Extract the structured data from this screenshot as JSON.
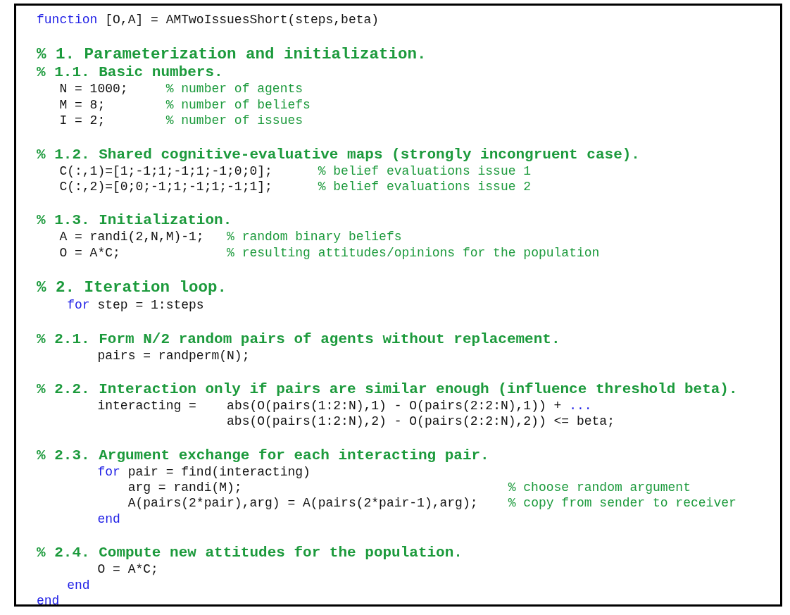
{
  "lines": [
    {
      "kind": "code",
      "segments": [
        {
          "kind": "keyword",
          "text": "function"
        },
        {
          "kind": "code",
          "text": " [O,A] = AMTwoIssuesShort(steps,beta)"
        }
      ]
    },
    {
      "kind": "blank"
    },
    {
      "kind": "section",
      "text": "% 1. Parameterization and initialization."
    },
    {
      "kind": "subsection",
      "text": "% 1.1. Basic numbers."
    },
    {
      "kind": "code",
      "segments": [
        {
          "kind": "code",
          "text": "   N = 1000;     "
        },
        {
          "kind": "comment",
          "text": "% number of agents"
        }
      ]
    },
    {
      "kind": "code",
      "segments": [
        {
          "kind": "code",
          "text": "   M = 8;        "
        },
        {
          "kind": "comment",
          "text": "% number of beliefs"
        }
      ]
    },
    {
      "kind": "code",
      "segments": [
        {
          "kind": "code",
          "text": "   I = 2;        "
        },
        {
          "kind": "comment",
          "text": "% number of issues"
        }
      ]
    },
    {
      "kind": "blank"
    },
    {
      "kind": "subsection",
      "text": "% 1.2. Shared cognitive-evaluative maps (strongly incongruent case)."
    },
    {
      "kind": "code",
      "segments": [
        {
          "kind": "code",
          "text": "   C(:,1)=[1;-1;1;-1;1;-1;0;0];      "
        },
        {
          "kind": "comment",
          "text": "% belief evaluations issue 1"
        }
      ]
    },
    {
      "kind": "code",
      "segments": [
        {
          "kind": "code",
          "text": "   C(:,2)=[0;0;-1;1;-1;1;-1;1];      "
        },
        {
          "kind": "comment",
          "text": "% belief evaluations issue 2"
        }
      ]
    },
    {
      "kind": "blank"
    },
    {
      "kind": "subsection",
      "text": "% 1.3. Initialization."
    },
    {
      "kind": "code",
      "segments": [
        {
          "kind": "code",
          "text": "   A = randi(2,N,M)-1;   "
        },
        {
          "kind": "comment",
          "text": "% random binary beliefs"
        }
      ]
    },
    {
      "kind": "code",
      "segments": [
        {
          "kind": "code",
          "text": "   O = A*C;              "
        },
        {
          "kind": "comment",
          "text": "% resulting attitudes/opinions for the population"
        }
      ]
    },
    {
      "kind": "blank"
    },
    {
      "kind": "section",
      "text": "% 2. Iteration loop."
    },
    {
      "kind": "code",
      "segments": [
        {
          "kind": "keyword",
          "text": "    for"
        },
        {
          "kind": "code",
          "text": " step = 1:steps"
        }
      ]
    },
    {
      "kind": "blank"
    },
    {
      "kind": "subsection",
      "text": "% 2.1. Form N/2 random pairs of agents without replacement."
    },
    {
      "kind": "code",
      "segments": [
        {
          "kind": "code",
          "text": "        pairs = randperm(N);"
        }
      ]
    },
    {
      "kind": "blank"
    },
    {
      "kind": "subsection",
      "text": "% 2.2. Interaction only if pairs are similar enough (influence threshold beta)."
    },
    {
      "kind": "code",
      "segments": [
        {
          "kind": "code",
          "text": "        interacting =    "
        },
        {
          "kind": "code",
          "text": "abs(O(pairs(1:2:N),1) - O(pairs(2:2:N),1)) + "
        },
        {
          "kind": "keyword",
          "text": "..."
        }
      ]
    },
    {
      "kind": "code",
      "segments": [
        {
          "kind": "code",
          "text": "                         abs(O(pairs(1:2:N),2) - O(pairs(2:2:N),2)) <= beta;"
        }
      ]
    },
    {
      "kind": "blank"
    },
    {
      "kind": "subsection",
      "text": "% 2.3. Argument exchange for each interacting pair."
    },
    {
      "kind": "code",
      "segments": [
        {
          "kind": "keyword",
          "text": "        for"
        },
        {
          "kind": "code",
          "text": " pair = find(interacting)"
        }
      ]
    },
    {
      "kind": "code",
      "segments": [
        {
          "kind": "code",
          "text": "            arg = randi(M);                                   "
        },
        {
          "kind": "comment",
          "text": "% choose random argument"
        }
      ]
    },
    {
      "kind": "code",
      "segments": [
        {
          "kind": "code",
          "text": "            A(pairs(2*pair),arg) = A(pairs(2*pair-1),arg);    "
        },
        {
          "kind": "comment",
          "text": "% copy from sender to receiver"
        }
      ]
    },
    {
      "kind": "code",
      "segments": [
        {
          "kind": "keyword",
          "text": "        end"
        }
      ]
    },
    {
      "kind": "blank"
    },
    {
      "kind": "subsection",
      "text": "% 2.4. Compute new attitudes for the population."
    },
    {
      "kind": "code",
      "segments": [
        {
          "kind": "code",
          "text": "        O = A*C;"
        }
      ]
    },
    {
      "kind": "code",
      "segments": [
        {
          "kind": "keyword",
          "text": "    end"
        }
      ]
    },
    {
      "kind": "code",
      "segments": [
        {
          "kind": "keyword",
          "text": "end"
        }
      ]
    }
  ]
}
